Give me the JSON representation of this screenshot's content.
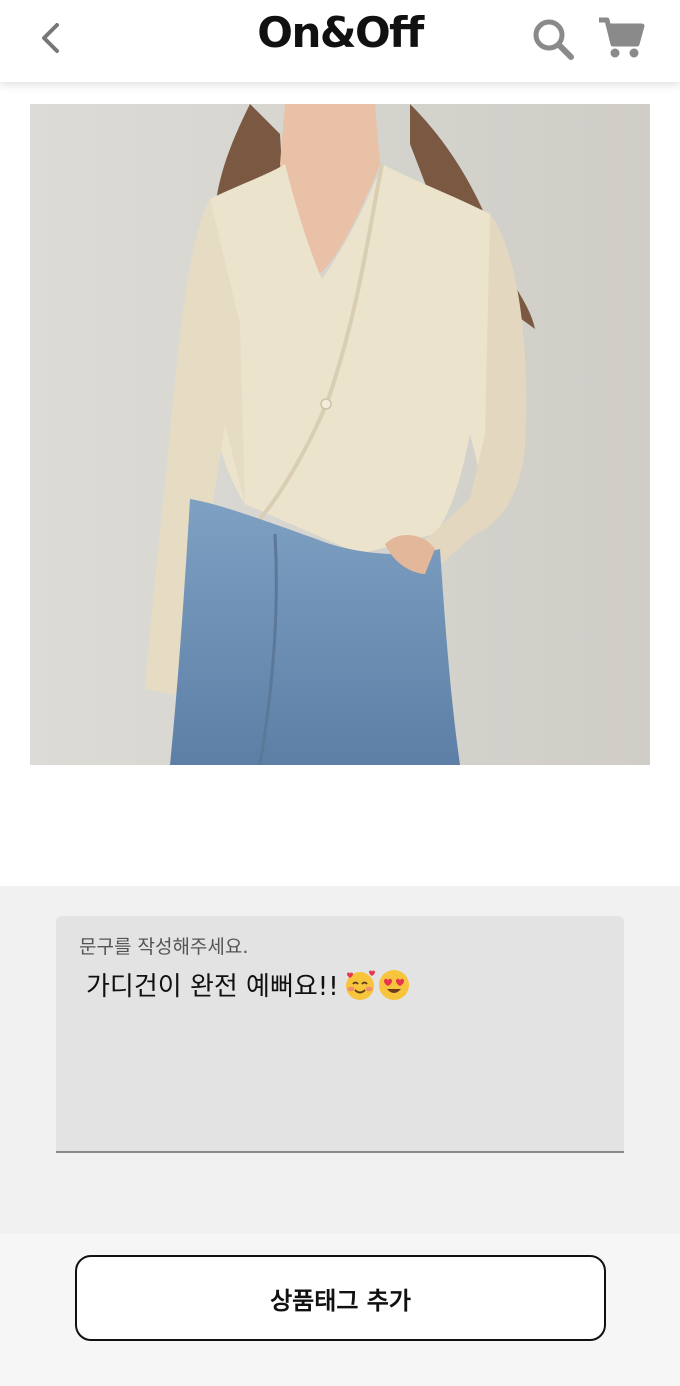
{
  "header": {
    "title": "On&Off",
    "icons": {
      "back": "chevron-left-icon",
      "search": "search-icon",
      "cart": "cart-icon"
    }
  },
  "post_image": {
    "alt": "Model wearing a cream wrap cardigan with blue denim skirt"
  },
  "caption": {
    "label": "문구를 작성해주세요.",
    "value": "가디건이 완전 예뻐요!!",
    "emojis": [
      "smiling-face-with-hearts",
      "heart-eyes"
    ]
  },
  "actions": {
    "add_tag_label": "상품태그 추가"
  },
  "colors": {
    "accent": "#111111",
    "field_bg": "#e3e3e3",
    "section_bg": "#f1f1f1"
  }
}
